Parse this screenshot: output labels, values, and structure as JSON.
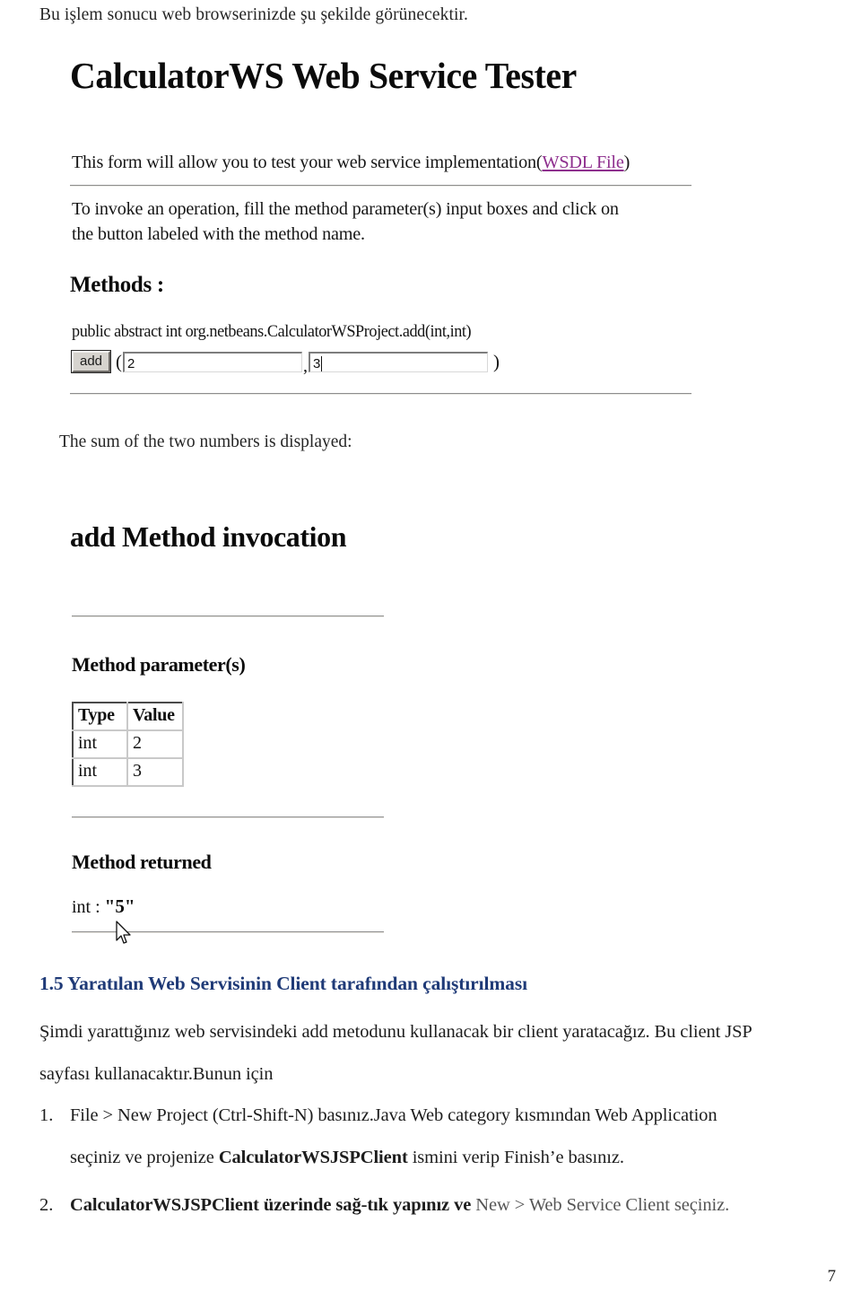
{
  "document": {
    "intro_line": "Bu işlem sonucu web browserinizde şu şekilde görünecektir.",
    "caption_sum": "The sum of the two numbers is displayed:",
    "page_number": "7"
  },
  "tester_screenshot": {
    "title": "CalculatorWS Web Service Tester",
    "intro_text": "This form will allow you to test your web service implementation",
    "wsdl_link_open_paren": "(",
    "wsdl_link_label": "WSDL File",
    "wsdl_link_close_paren": ")",
    "instruction_line1": "To invoke an operation, fill the method parameter(s) input boxes and click on",
    "instruction_line2": "the button labeled with the method name.",
    "methods_label": "Methods :",
    "method_signature": "public abstract int org.netbeans.CalculatorWSProject.add(int,int)",
    "invoke_button_label": "add",
    "open_paren": "(",
    "comma": ",",
    "close_paren": ")",
    "param_inputs": [
      {
        "value": "2",
        "placeholder": ""
      },
      {
        "value": "3",
        "placeholder": ""
      }
    ]
  },
  "invocation_screenshot": {
    "title": "add Method invocation",
    "params_heading": "Method parameter(s)",
    "table": {
      "headers": [
        "Type",
        "Value"
      ],
      "rows": [
        {
          "type": "int",
          "value": "2"
        },
        {
          "type": "int",
          "value": "3"
        }
      ]
    },
    "returned_heading": "Method returned",
    "returned_type": "int : ",
    "returned_value": "\"5\""
  },
  "section": {
    "heading": "1.5 Yaratılan Web Servisinin Client tarafından çalıştırılması",
    "paragraph_line1": "Şimdi yarattığınız web servisindeki add metodunu kullanacak bir client yaratacağız. Bu client JSP",
    "paragraph_line2": "sayfası kullanacaktır.Bunun için",
    "list": [
      {
        "number": "1.",
        "line1": "File > New Project (Ctrl-Shift-N) basınız.Java Web category kısmından Web Application",
        "line2_before": "seçiniz ve projenize ",
        "line2_bold": "CalculatorWSJSPClient",
        "line2_after": " ismini verip Finish’e basınız."
      },
      {
        "number": "2.",
        "line1_bold": "CalculatorWSJSPClient üzerinde sağ-tık yapınız ve ",
        "line1_menu": "New > Web Service Client seçiniz."
      }
    ]
  },
  "colors": {
    "heading_blue": "#1f3a77",
    "visited_link_purple": "#8e2f8e",
    "button_face": "#d6d3ce"
  }
}
